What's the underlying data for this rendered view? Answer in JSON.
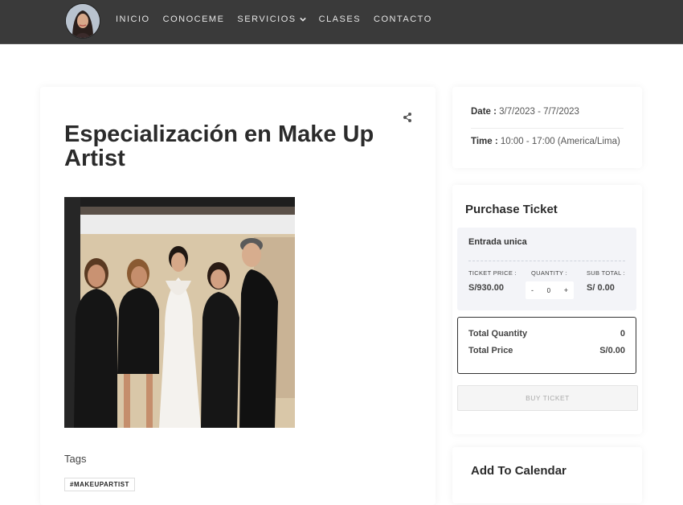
{
  "nav": {
    "items": [
      {
        "label": "INICIO"
      },
      {
        "label": "CONOCEME"
      },
      {
        "label": "SERVICIOS",
        "has_dropdown": true
      },
      {
        "label": "CLASES"
      },
      {
        "label": "CONTACTO"
      }
    ]
  },
  "event": {
    "title": "Especialización en Make Up Artist",
    "tags_label": "Tags",
    "tags": [
      "#MAKEUPARTIST"
    ]
  },
  "schedule": {
    "date_label": "Date :",
    "date_value": "3/7/2023 - 7/7/2023",
    "time_label": "Time :",
    "time_value": "10:00 - 17:00 (America/Lima)"
  },
  "ticket": {
    "heading": "Purchase Ticket",
    "name": "Entrada unica",
    "price_label": "TICKET PRICE :",
    "price_value": "S/930.00",
    "quantity_label": "QUANTITY :",
    "minus": "-",
    "quantity_value": "0",
    "plus": "+",
    "subtotal_label": "SUB TOTAL :",
    "subtotal_value": "S/ 0.00",
    "total_quantity_label": "Total Quantity",
    "total_quantity_value": "0",
    "total_price_label": "Total Price",
    "total_price_value": "S/0.00",
    "buy_label": "BUY TICKET"
  },
  "calendar": {
    "heading": "Add To Calendar"
  },
  "colors": {
    "header_bg": "#3a3a3a",
    "ticket_box_bg": "#f3f4f8"
  },
  "icons": [
    "avatar-photo",
    "chevron-down-icon",
    "share-icon"
  ]
}
